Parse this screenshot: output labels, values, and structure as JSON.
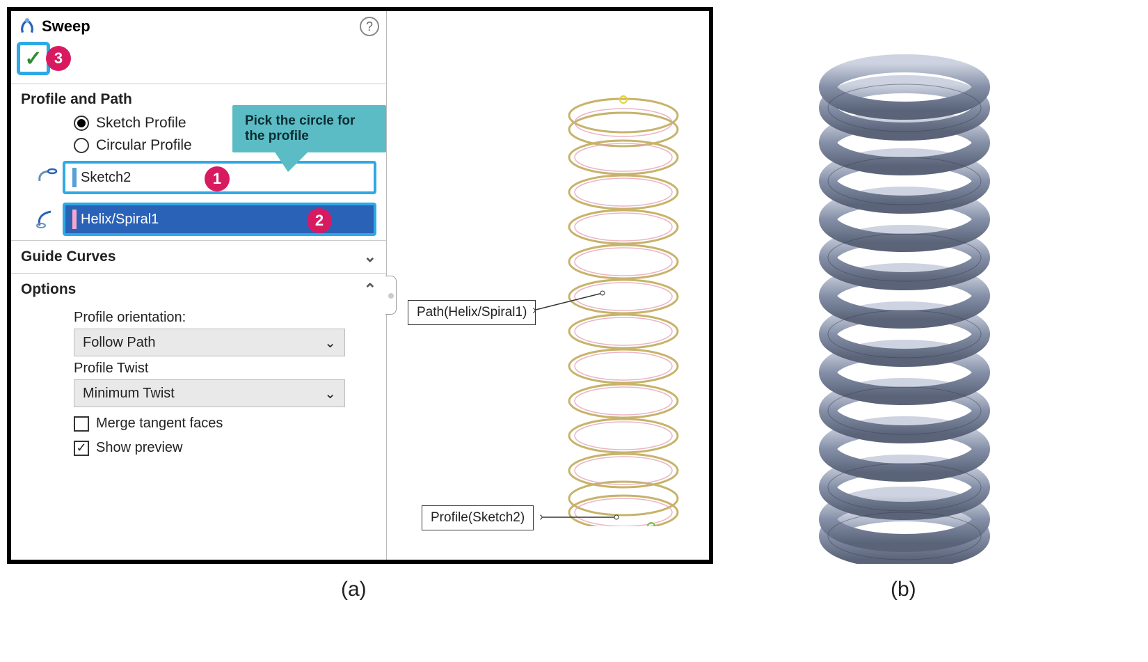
{
  "panel": {
    "title": "Sweep",
    "section1": "Profile and Path",
    "radio_sketch": "Sketch Profile",
    "radio_circular": "Circular Profile",
    "profile_value": "Sketch2",
    "path_value": "Helix/Spiral1",
    "section_guide": "Guide Curves",
    "section_options": "Options",
    "opt_profile_orientation_label": "Profile orientation:",
    "opt_profile_orientation_value": "Follow Path",
    "opt_profile_twist_label": "Profile Twist",
    "opt_profile_twist_value": "Minimum Twist",
    "chk_merge": "Merge tangent faces",
    "chk_preview": "Show preview"
  },
  "tooltip": "Pick the circle for the profile",
  "callouts": {
    "ok": "3",
    "profile": "1",
    "path": "2"
  },
  "viewport_labels": {
    "path": "Path(Helix/Spiral1)",
    "profile": "Profile(Sketch2)"
  },
  "figure_labels": {
    "a": "(a)",
    "b": "(b)"
  }
}
